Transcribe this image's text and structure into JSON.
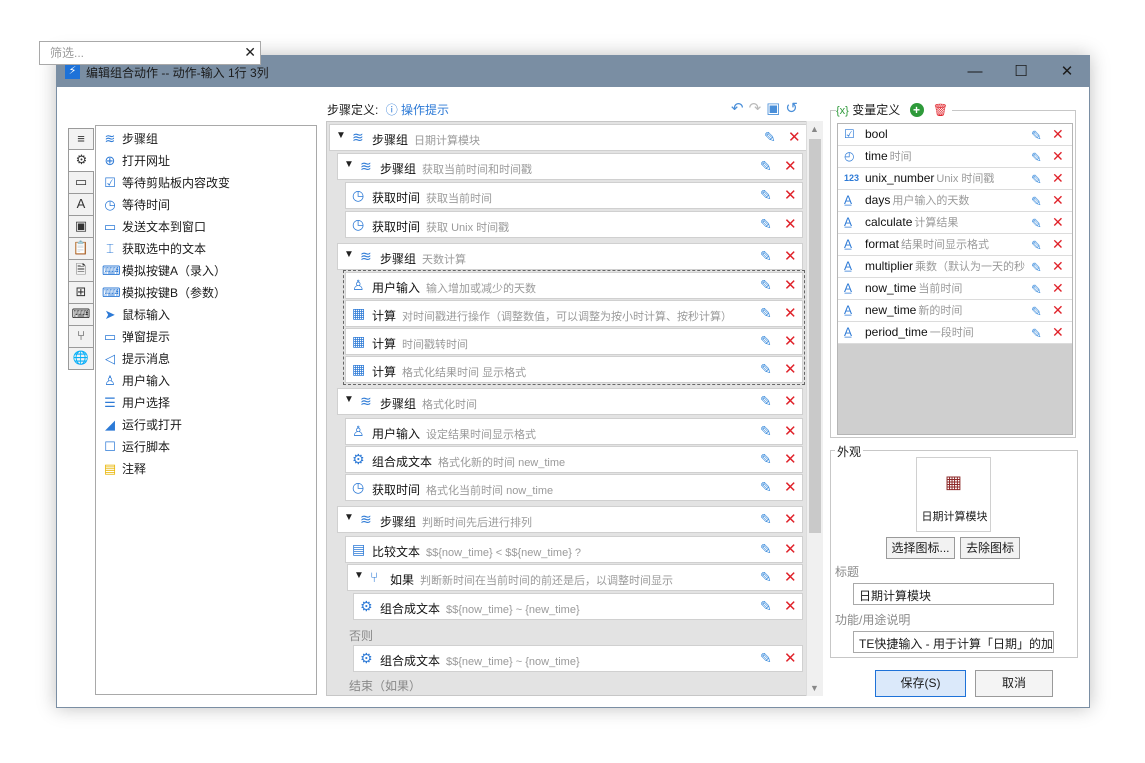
{
  "window": {
    "title": "编辑组合动作 -- 动作-输入 1行 3列",
    "minimize": "—",
    "maximize": "☐",
    "close": "✕"
  },
  "left": {
    "filter_placeholder": "筛选...",
    "tabs": [
      "≡",
      "⚙",
      "▭",
      "A",
      "▣",
      "📋",
      "🗎",
      "⊞",
      "⌨",
      "⑂",
      "🌐"
    ],
    "actions": [
      {
        "label": "步骤组",
        "icon": "layers-icon"
      },
      {
        "label": "打开网址",
        "icon": "globe-icon"
      },
      {
        "label": "等待剪贴板内容改变",
        "icon": "clipboard-icon"
      },
      {
        "label": "等待时间",
        "icon": "timer-icon"
      },
      {
        "label": "发送文本到窗口",
        "icon": "send-text-icon"
      },
      {
        "label": "获取选中的文本",
        "icon": "text-cursor-icon"
      },
      {
        "label": "模拟按键A（录入）",
        "icon": "keyboard-icon"
      },
      {
        "label": "模拟按键B（参数）",
        "icon": "keyboard-icon"
      },
      {
        "label": "鼠标输入",
        "icon": "cursor-icon"
      },
      {
        "label": "弹窗提示",
        "icon": "popup-icon"
      },
      {
        "label": "提示消息",
        "icon": "megaphone-icon"
      },
      {
        "label": "用户输入",
        "icon": "user-input-icon"
      },
      {
        "label": "用户选择",
        "icon": "list-icon"
      },
      {
        "label": "运行或打开",
        "icon": "paper-plane-icon"
      },
      {
        "label": "运行脚本",
        "icon": "script-icon"
      },
      {
        "label": "注释",
        "icon": "note-icon"
      }
    ]
  },
  "middle": {
    "title": "步骤定义:",
    "hint": "操作提示",
    "rows": [
      {
        "kind": "group",
        "label": "步骤组",
        "desc": "日期计算模块"
      },
      {
        "kind": "group",
        "label": "步骤组",
        "desc": "获取当前时间和时间戳"
      },
      {
        "kind": "item",
        "label": "获取时间",
        "desc": "获取当前时间"
      },
      {
        "kind": "item",
        "label": "获取时间",
        "desc": "获取 Unix 时间戳"
      },
      {
        "kind": "group",
        "label": "步骤组",
        "desc": "天数计算"
      },
      {
        "kind": "item",
        "label": "用户输入",
        "desc": "输入增加或减少的天数"
      },
      {
        "kind": "item",
        "label": "计算",
        "desc": "对时间戳进行操作（调整数值，可以调整为按小时计算、按秒计算）"
      },
      {
        "kind": "item",
        "label": "计算",
        "desc": "时间戳转时间"
      },
      {
        "kind": "item",
        "label": "计算",
        "desc": "格式化结果时间 显示格式"
      },
      {
        "kind": "group",
        "label": "步骤组",
        "desc": "格式化时间"
      },
      {
        "kind": "item",
        "label": "用户输入",
        "desc": "设定结果时间显示格式"
      },
      {
        "kind": "item",
        "label": "组合成文本",
        "desc": "格式化新的时间 new_time"
      },
      {
        "kind": "item",
        "label": "获取时间",
        "desc": "格式化当前时间 now_time"
      },
      {
        "kind": "group",
        "label": "步骤组",
        "desc": "判断时间先后进行排列"
      },
      {
        "kind": "item",
        "label": "比较文本",
        "desc": "$${now_time} < $${new_time} ?"
      },
      {
        "kind": "if",
        "label": "如果",
        "desc": "判断新时间在当前时间的前还是后，以调整时间显示"
      },
      {
        "kind": "item",
        "label": "组合成文本",
        "desc": "$${now_time} ~ {new_time}"
      },
      {
        "kind": "plain",
        "label": "否则"
      },
      {
        "kind": "item",
        "label": "组合成文本",
        "desc": "$${new_time} ~ {now_time}"
      },
      {
        "kind": "plain",
        "label": "结束（如果）"
      }
    ]
  },
  "variables": {
    "title": "变量定义",
    "curly": "{x}",
    "items": [
      {
        "name": "bool",
        "desc": "",
        "icon": "checkbox-icon"
      },
      {
        "name": "time",
        "desc": "时间",
        "icon": "clock-icon"
      },
      {
        "name": "unix_number",
        "desc": "Unix 时间戳",
        "icon": "number-icon"
      },
      {
        "name": "days",
        "desc": "用户输入的天数",
        "icon": "text-var-icon"
      },
      {
        "name": "calculate",
        "desc": "计算结果",
        "icon": "text-var-icon"
      },
      {
        "name": "format",
        "desc": "结果时间显示格式",
        "icon": "text-var-icon"
      },
      {
        "name": "multiplier",
        "desc": "乘数（默认为一天的秒",
        "icon": "text-var-icon"
      },
      {
        "name": "now_time",
        "desc": "当前时间",
        "icon": "text-var-icon"
      },
      {
        "name": "new_time",
        "desc": "新的时间",
        "icon": "text-var-icon"
      },
      {
        "name": "period_time",
        "desc": "一段时间",
        "icon": "text-var-icon"
      }
    ]
  },
  "appearance": {
    "legend": "外观",
    "icon_caption": "日期计算模块",
    "choose_icon": "选择图标...",
    "remove_icon": "去除图标",
    "title_label": "标题",
    "title_value": "日期计算模块",
    "desc_label": "功能/用途说明",
    "desc_value": "TE快捷输入 - 用于计算「日期」的加减"
  },
  "footer": {
    "save": "保存(S)",
    "cancel": "取消"
  }
}
